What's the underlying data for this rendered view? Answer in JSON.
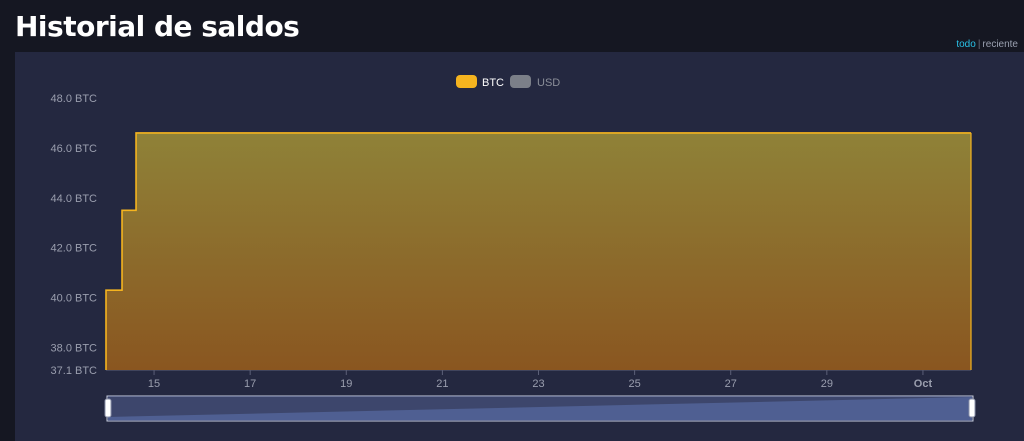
{
  "header": {
    "title": "Historial de saldos",
    "range_all": "todo",
    "range_separator": "|",
    "range_recent": "reciente"
  },
  "colors": {
    "btc_series": "#f5b41f",
    "usd_series": "#7b7f88",
    "background": "#151722",
    "panel": "#242840",
    "range_active": "#29c0e6"
  },
  "chart_data": {
    "type": "area",
    "title": "",
    "xlabel": "",
    "ylabel": "",
    "legend": {
      "position": "top-center",
      "items": [
        {
          "name": "BTC",
          "active": true
        },
        {
          "name": "USD",
          "active": false
        }
      ]
    },
    "y_ticks": [
      "37.1 BTC",
      "38.0 BTC",
      "40.0 BTC",
      "42.0 BTC",
      "44.0 BTC",
      "46.0 BTC",
      "48.0 BTC"
    ],
    "y_tick_values": [
      37.1,
      38,
      40,
      42,
      44,
      46,
      48
    ],
    "ylim": [
      37.1,
      48
    ],
    "x_ticks": [
      "15",
      "17",
      "19",
      "21",
      "23",
      "25",
      "27",
      "29",
      "Oct"
    ],
    "x_tick_values": [
      "2023-09-15",
      "2023-09-17",
      "2023-09-19",
      "2023-09-21",
      "2023-09-23",
      "2023-09-25",
      "2023-09-27",
      "2023-09-29",
      "2023-10-01"
    ],
    "xlim": [
      "2023-09-14",
      "2023-10-02"
    ],
    "grid": false,
    "step": true,
    "series": [
      {
        "name": "BTC",
        "points": [
          {
            "x": "2023-09-14",
            "y": 40.3
          },
          {
            "x": "2023-09-14T08:00",
            "y": 43.5
          },
          {
            "x": "2023-09-14T15:00",
            "y": 46.6
          },
          {
            "x": "2023-10-02",
            "y": 46.6
          }
        ]
      }
    ],
    "zoom_slider": {
      "start": 0,
      "end": 1
    }
  }
}
